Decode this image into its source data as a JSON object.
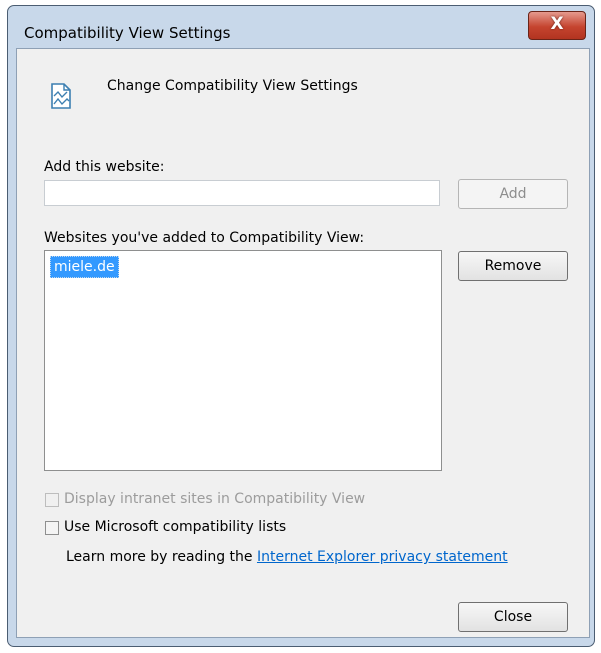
{
  "window": {
    "title": "Compatibility View Settings",
    "close_glyph": "X"
  },
  "header": {
    "icon": "compatibility-view-icon",
    "text": "Change Compatibility View Settings"
  },
  "add_section": {
    "label": "Add this website:",
    "input_value": "",
    "add_button": "Add"
  },
  "list_section": {
    "label": "Websites you've added to Compatibility View:",
    "items": [
      "miele.de"
    ],
    "selected": "miele.de",
    "remove_button": "Remove"
  },
  "options": {
    "intranet": {
      "label": "Display intranet sites in Compatibility View",
      "checked": false,
      "enabled": false
    },
    "ms_lists": {
      "label": "Use Microsoft compatibility lists",
      "checked": false,
      "enabled": true
    }
  },
  "learn_more": {
    "prefix": "Learn more by reading the ",
    "link_text": "Internet Explorer privacy statement"
  },
  "close_button": "Close",
  "colors": {
    "selection": "#3399ff",
    "link": "#0066cc",
    "close_red": "#c5442f"
  }
}
